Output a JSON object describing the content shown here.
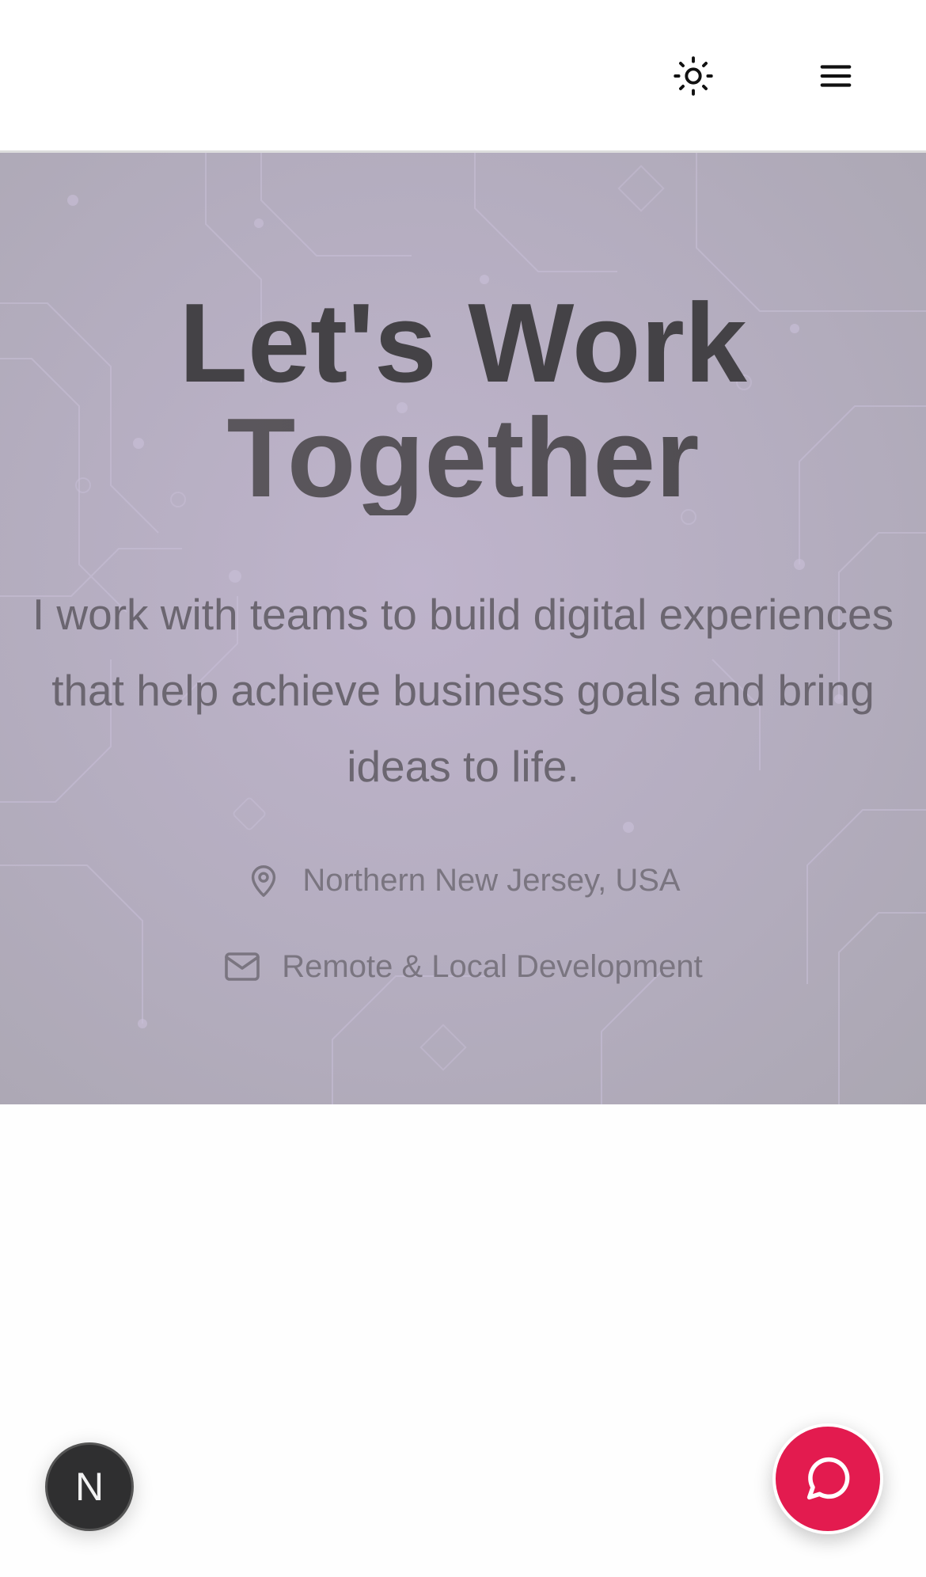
{
  "header": {
    "theme_toggle_icon": "sun-icon",
    "menu_icon": "hamburger-menu-icon"
  },
  "hero": {
    "title_line1": "Let's Work",
    "title_line2": "Together",
    "subtitle": "I work with teams to build digital experiences that help achieve business goals and bring ideas to life.",
    "location": "Northern New Jersey, USA",
    "location_icon": "map-pin-icon",
    "availability": "Remote & Local Development",
    "availability_icon": "mail-icon"
  },
  "floating": {
    "dev_badge_label": "N",
    "chat_icon": "chat-bubble-icon"
  },
  "colors": {
    "accent": "#e31b4f",
    "title": "#444246",
    "body_text": "#6b6670",
    "hero_bg": "#b4adbf"
  }
}
